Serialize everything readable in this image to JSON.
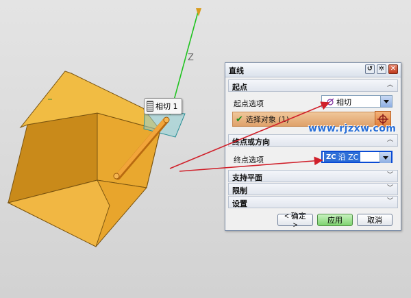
{
  "viewport": {
    "axis_label": "Z",
    "tooltip": "相切 1"
  },
  "dialog": {
    "title": "直线",
    "title_buttons": [
      "reset-icon",
      "gear-icon",
      "close-icon"
    ],
    "sections": {
      "start": {
        "header": "起点",
        "option_label": "起点选项",
        "option_value": "相切",
        "select_object": "选择对象 (1)"
      },
      "end": {
        "header": "终点或方向",
        "option_label": "终点选项",
        "option_value": "沿 ZC",
        "option_prefix": "ZC"
      },
      "support_plane": {
        "header": "支持平面"
      },
      "limits": {
        "header": "限制"
      },
      "settings": {
        "header": "设置"
      }
    },
    "buttons": {
      "ok": "< 确定 >",
      "apply": "应用",
      "cancel": "取消"
    }
  },
  "watermark": "www.rjzxw.com",
  "colors": {
    "block": "#f0b23a",
    "axis": "#1fc31f",
    "annotation": "#d0202a",
    "accent": "#2f6fd6"
  }
}
